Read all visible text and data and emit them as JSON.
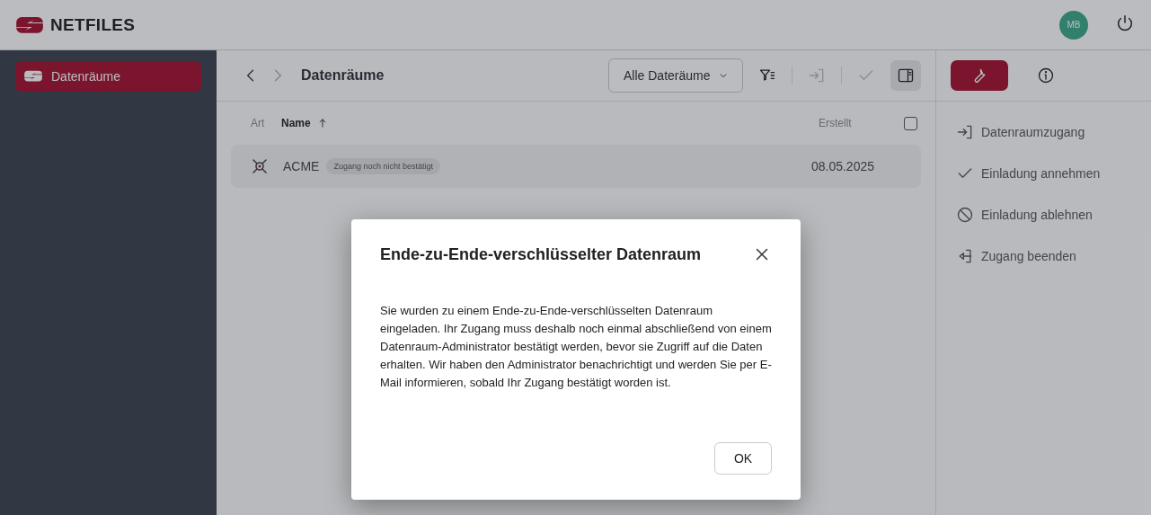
{
  "header": {
    "brand": "NETFILES",
    "avatar": "MB"
  },
  "sidebar": {
    "items": [
      {
        "label": "Datenräume",
        "selected": true
      }
    ]
  },
  "toolbar": {
    "title": "Datenräume",
    "filter_select": "Alle Dateräume",
    "buttons": [
      {
        "kind": "filter",
        "disabled": false
      },
      {
        "kind": "enter",
        "disabled": true
      },
      {
        "kind": "check",
        "disabled": true
      },
      {
        "kind": "panel",
        "disabled": false
      }
    ]
  },
  "table": {
    "columns": [
      "Art",
      "Name",
      "Erstellt"
    ],
    "select_all_checked": false,
    "rows": [
      {
        "name": "ACME",
        "badge": "Zugang noch nicht bestätigt",
        "created": "08.05.2025"
      }
    ]
  },
  "panel": {
    "tabs": [
      {
        "kind": "tools",
        "selected": true
      },
      {
        "kind": "info",
        "selected": false
      }
    ],
    "actions": [
      {
        "kind": "enter",
        "label": "Datenraumzugang"
      },
      {
        "kind": "check",
        "label": "Einladung annehmen"
      },
      {
        "kind": "deny",
        "label": "Einladung ablehnen"
      },
      {
        "kind": "leave",
        "label": "Zugang beenden"
      }
    ]
  },
  "dialog": {
    "title": "Ende-zu-Ende-verschlüsselter Datenraum",
    "body": "Sie wurden zu einem Ende-zu-Ende-verschlüsselten Datenraum eingeladen. Ihr Zugang muss deshalb noch einmal abschließend von einem Datenraum-Administrator bestätigt werden, bevor sie Zugriff auf die Daten erhalten. Wir haben den Administrator benachrichtigt und werden Sie per E-Mail informieren, sobald Ihr Zugang bestätigt worden ist.",
    "button": "OK"
  }
}
